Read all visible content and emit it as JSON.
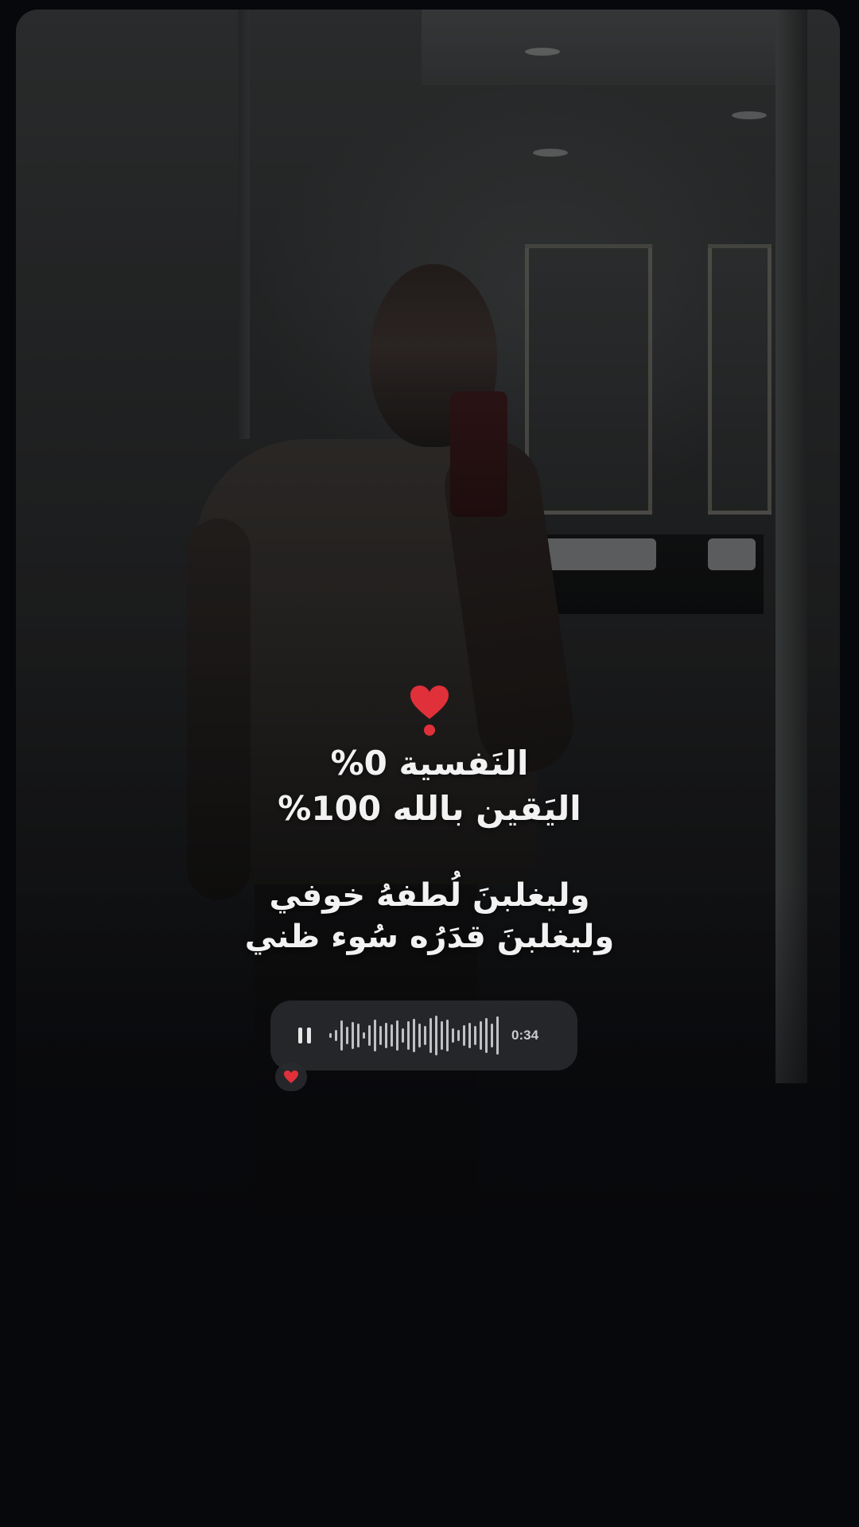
{
  "story": {
    "emoji": "❣️",
    "line_1": "النَفسية 0%",
    "line_2": "اليَقين بالله 100%",
    "line_3": "وليغلبنَ لُطفهُ خوفي",
    "line_4": "وليغلبنَ قدَرُه سُوء ظني"
  },
  "voice_message": {
    "state": "playing",
    "control": "pause-icon",
    "duration": "0:34"
  },
  "reaction": {
    "icon": "heart-icon",
    "color": "#e0303a"
  }
}
